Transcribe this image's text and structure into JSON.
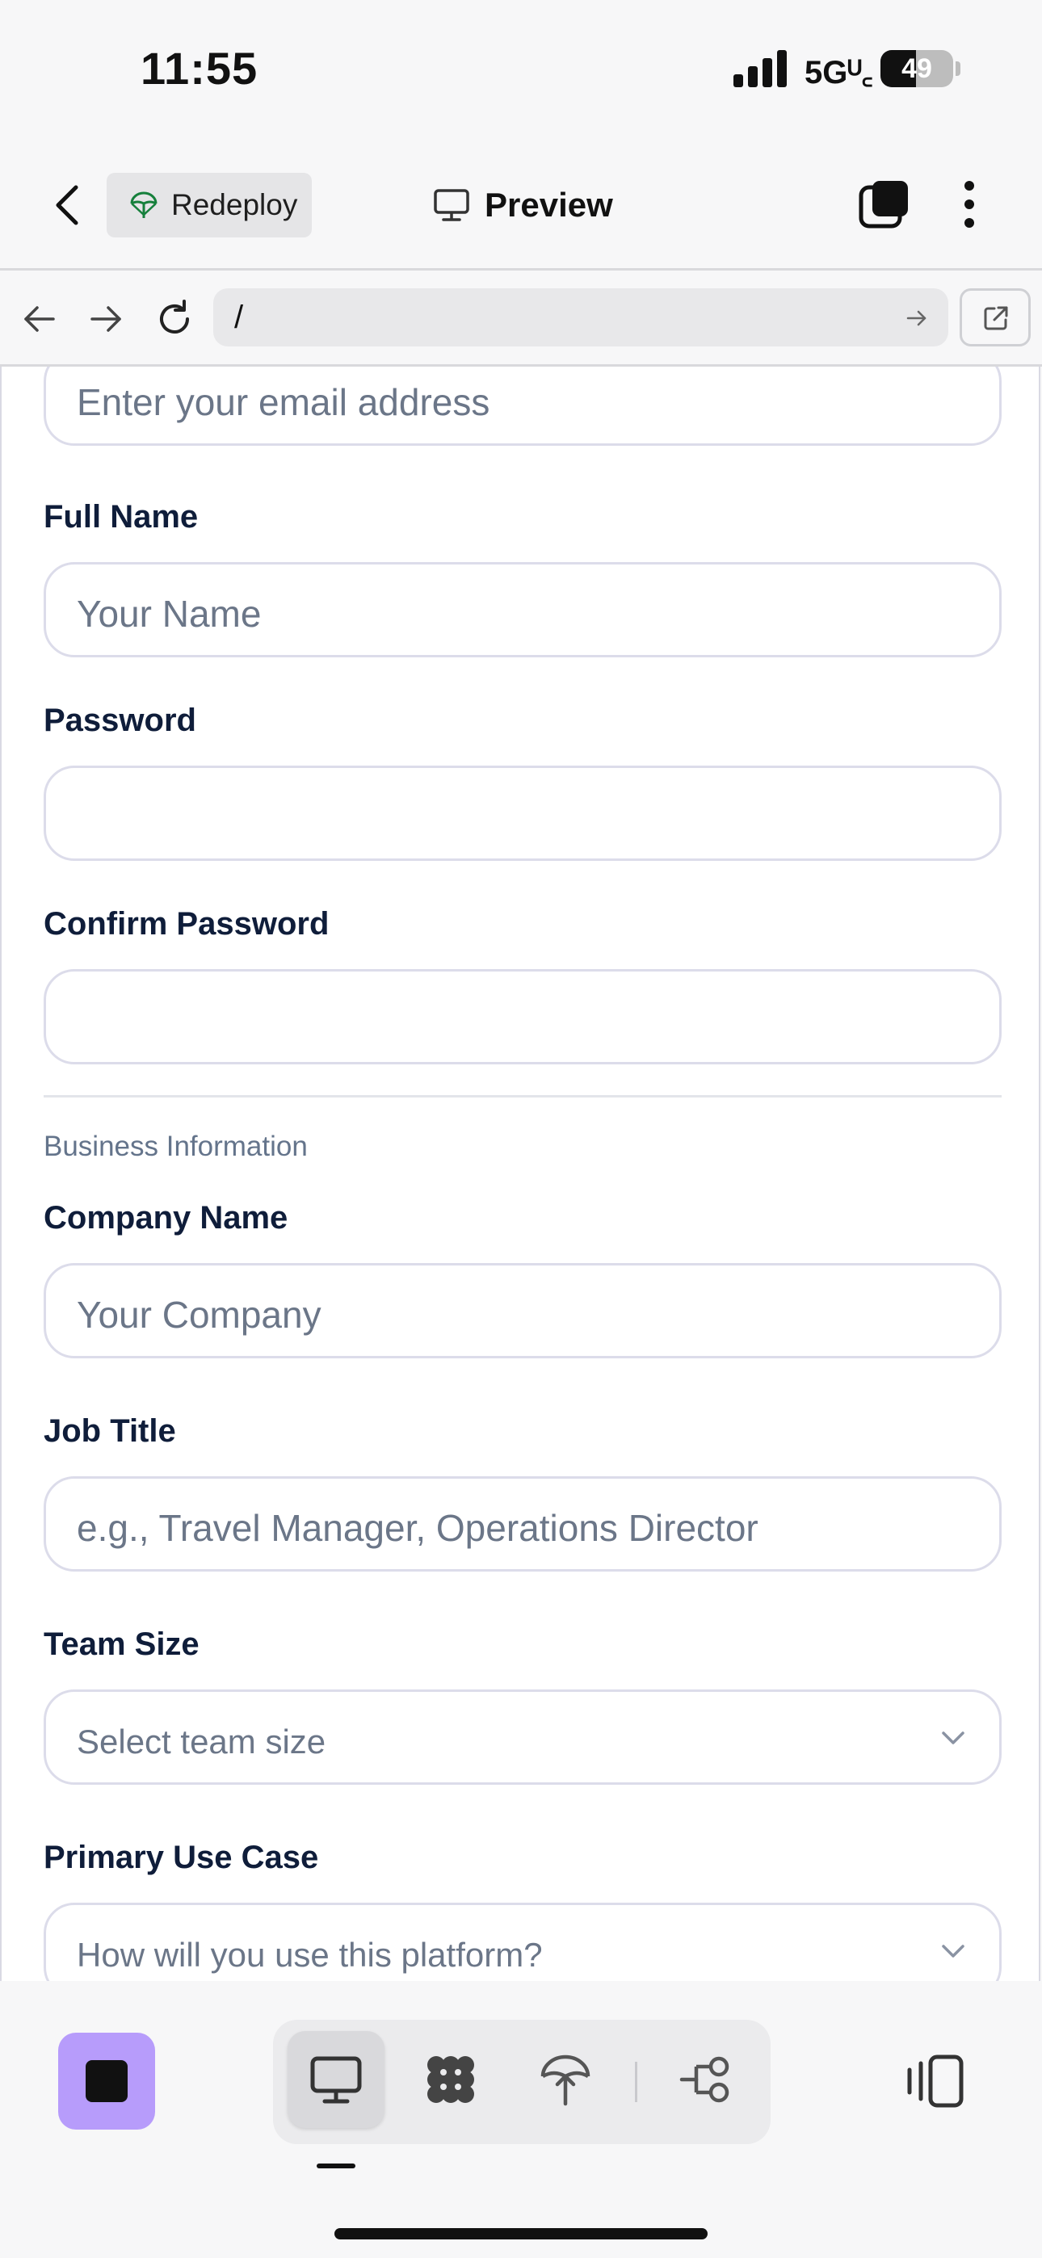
{
  "status_bar": {
    "time": "11:55",
    "network": "5Gᵁ꜀",
    "battery_level": "49",
    "battery_fraction": 0.49
  },
  "header": {
    "back_icon": "chevron-left-icon",
    "deploy_label": "Redeploy",
    "deploy_icon": "parachute-icon",
    "preview_label": "Preview",
    "preview_icon": "monitor-icon",
    "tabs_icon": "tabs-icon",
    "more_icon": "more-vertical-icon"
  },
  "browser": {
    "back_icon": "arrow-left-icon",
    "forward_icon": "arrow-right-icon",
    "reload_icon": "reload-icon",
    "url": "/",
    "go_icon": "arrow-right-icon",
    "external_icon": "external-link-icon"
  },
  "form": {
    "email": {
      "placeholder": "Enter your email address"
    },
    "full_name": {
      "label": "Full Name",
      "placeholder": "Your Name"
    },
    "password": {
      "label": "Password",
      "placeholder": ""
    },
    "confirm_password": {
      "label": "Confirm Password",
      "placeholder": ""
    },
    "business_section": "Business Information",
    "company_name": {
      "label": "Company Name",
      "placeholder": "Your Company"
    },
    "job_title": {
      "label": "Job Title",
      "placeholder": "e.g., Travel Manager, Operations Director"
    },
    "team_size": {
      "label": "Team Size",
      "selected": "Select team size"
    },
    "use_case": {
      "label": "Primary Use Case",
      "selected": "How will you use this platform?"
    }
  },
  "toolbar": {
    "stop_icon": "stop-icon",
    "items": [
      "monitor-icon",
      "grid-blob-icon",
      "parachute-icon",
      "workflow-icon"
    ],
    "active": "monitor-icon",
    "panel_icon": "panel-toggle-icon"
  },
  "colors": {
    "accent": "#b79cfb",
    "border": "#dcdcea",
    "placeholder": "#6b7688",
    "label": "#0f1d3a"
  }
}
